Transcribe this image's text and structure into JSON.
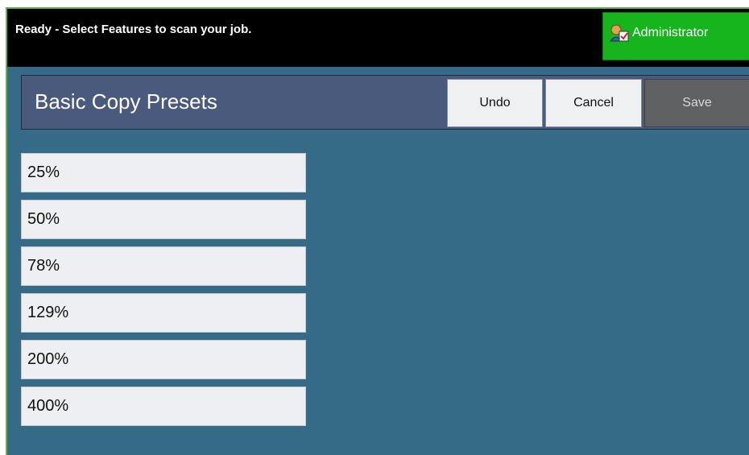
{
  "status": {
    "message": "Ready - Select Features to scan your job."
  },
  "admin": {
    "label": "Administrator",
    "icon": "administrator-icon"
  },
  "header": {
    "title": "Basic Copy Presets",
    "undo_label": "Undo",
    "cancel_label": "Cancel",
    "save_label": "Save"
  },
  "presets": [
    "25%",
    "50%",
    "78%",
    "129%",
    "200%",
    "400%"
  ],
  "colors": {
    "status_bar": "#000000",
    "admin_button": "#16b51d",
    "header_bar": "#4a5a7c",
    "background": "#356b86",
    "save_disabled": "#5f6062"
  }
}
